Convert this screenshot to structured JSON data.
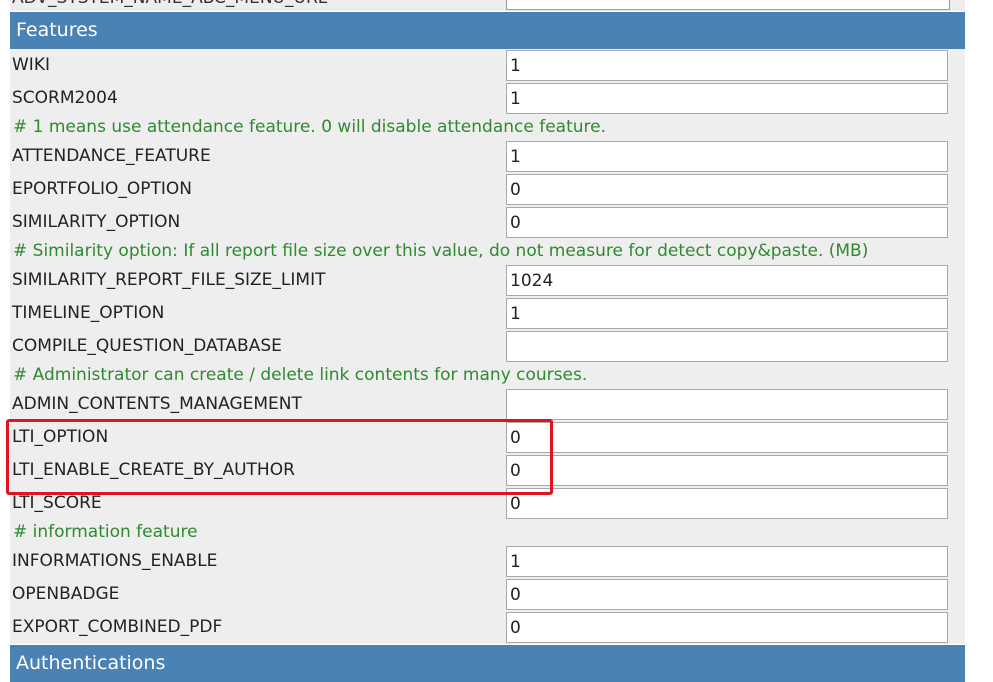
{
  "top_partial": {
    "key": "ADV_SYSTEM_NAME_ABC_MENU_URL"
  },
  "features_header": "Features",
  "auth_header": "Authentications",
  "rows": [
    {
      "type": "setting",
      "key": "WIKI",
      "value": "1"
    },
    {
      "type": "setting",
      "key": "SCORM2004",
      "value": "1"
    },
    {
      "type": "comment",
      "text": "# 1 means use attendance feature. 0 will disable attendance feature."
    },
    {
      "type": "setting",
      "key": "ATTENDANCE_FEATURE",
      "value": "1"
    },
    {
      "type": "setting",
      "key": "EPORTFOLIO_OPTION",
      "value": "0"
    },
    {
      "type": "setting",
      "key": "SIMILARITY_OPTION",
      "value": "0"
    },
    {
      "type": "comment",
      "text": "# Similarity option: If all report file size over this value, do not measure for detect copy&paste. (MB)"
    },
    {
      "type": "setting",
      "key": "SIMILARITY_REPORT_FILE_SIZE_LIMIT",
      "value": "1024"
    },
    {
      "type": "setting",
      "key": "TIMELINE_OPTION",
      "value": "1"
    },
    {
      "type": "setting",
      "key": "COMPILE_QUESTION_DATABASE",
      "value": ""
    },
    {
      "type": "comment",
      "text": "# Administrator can create / delete link contents for many courses."
    },
    {
      "type": "setting",
      "key": "ADMIN_CONTENTS_MANAGEMENT",
      "value": ""
    },
    {
      "type": "setting",
      "key": "LTI_OPTION",
      "value": "0"
    },
    {
      "type": "setting",
      "key": "LTI_ENABLE_CREATE_BY_AUTHOR",
      "value": "0"
    },
    {
      "type": "setting",
      "key": "LTI_SCORE",
      "value": "0"
    },
    {
      "type": "comment",
      "text": "# information feature"
    },
    {
      "type": "setting",
      "key": "INFORMATIONS_ENABLE",
      "value": "1"
    },
    {
      "type": "setting",
      "key": "OPENBADGE",
      "value": "0"
    },
    {
      "type": "setting",
      "key": "EXPORT_COMBINED_PDF",
      "value": "0"
    }
  ],
  "colors": {
    "header_bg": "#4a82b4",
    "row_bg": "#eeeeee",
    "comment_text": "#2f8a2f",
    "highlight_border": "#e0141e"
  }
}
